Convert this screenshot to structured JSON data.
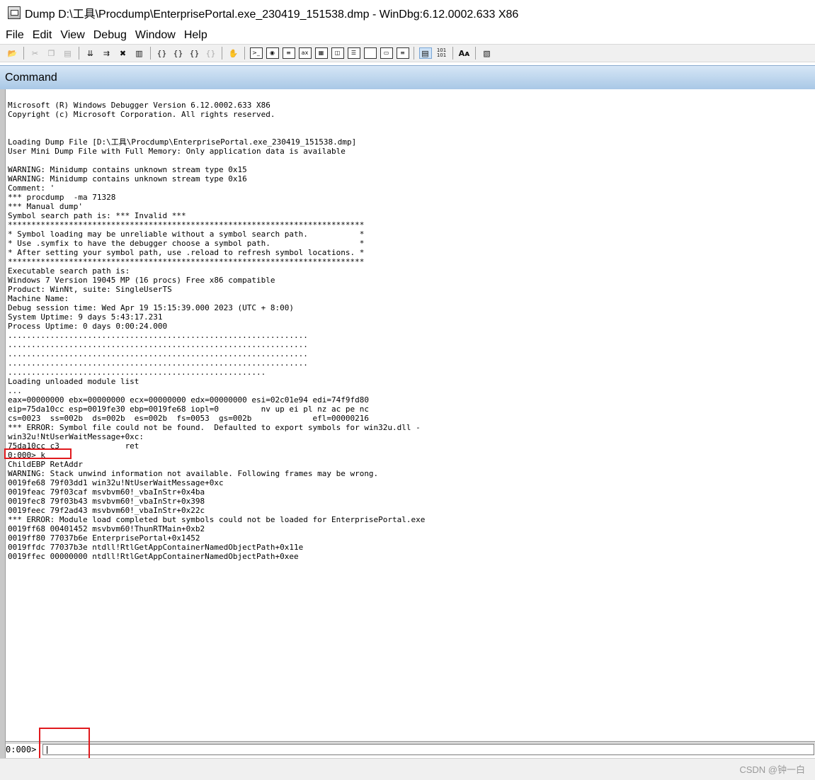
{
  "window": {
    "title": "Dump D:\\工具\\Procdump\\EnterprisePortal.exe_230419_151538.dmp - WinDbg:6.12.0002.633 X86"
  },
  "menu": [
    "File",
    "Edit",
    "View",
    "Debug",
    "Window",
    "Help"
  ],
  "toolbar": {
    "buttons": [
      "open-icon",
      "cut-icon",
      "copy-icon",
      "paste-icon",
      "step-into-icon",
      "step-over-icon",
      "break-icon",
      "restart-icon",
      "go-icon",
      "step-out-icon",
      "run-to-cursor-icon",
      "disabled-icon",
      "hand-icon",
      "command-window-icon",
      "watch-icon",
      "locals-icon",
      "registers-icon",
      "memory-icon",
      "call-stack-icon",
      "disassembly-icon",
      "scratch-pad-icon",
      "processes-icon",
      "source-mode-icon",
      "hex-icon",
      "font-icon",
      "options-icon"
    ]
  },
  "command_window": {
    "title": "Command",
    "output": "Microsoft (R) Windows Debugger Version 6.12.0002.633 X86\nCopyright (c) Microsoft Corporation. All rights reserved.\n\n\nLoading Dump File [D:\\工具\\Procdump\\EnterprisePortal.exe_230419_151538.dmp]\nUser Mini Dump File with Full Memory: Only application data is available\n\nWARNING: Minidump contains unknown stream type 0x15\nWARNING: Minidump contains unknown stream type 0x16\nComment: '\n*** procdump  -ma 71328\n*** Manual dump'\nSymbol search path is: *** Invalid ***\n****************************************************************************\n* Symbol loading may be unreliable without a symbol search path.           *\n* Use .symfix to have the debugger choose a symbol path.                   *\n* After setting your symbol path, use .reload to refresh symbol locations. *\n****************************************************************************\nExecutable search path is:\nWindows 7 Version 19045 MP (16 procs) Free x86 compatible\nProduct: WinNt, suite: SingleUserTS\nMachine Name:\nDebug session time: Wed Apr 19 15:15:39.000 2023 (UTC + 8:00)\nSystem Uptime: 9 days 5:43:17.231\nProcess Uptime: 0 days 0:00:24.000\n................................................................\n................................................................\n................................................................\n................................................................\n.......................................................\nLoading unloaded module list\n...\neax=00000000 ebx=00000000 ecx=00000000 edx=00000000 esi=02c01e94 edi=74f9fd80\neip=75da10cc esp=0019fe30 ebp=0019fe68 iopl=0         nv up ei pl nz ac pe nc\ncs=0023  ss=002b  ds=002b  es=002b  fs=0053  gs=002b             efl=00000216\n*** ERROR: Symbol file could not be found.  Defaulted to export symbols for win32u.dll -\nwin32u!NtUserWaitMessage+0xc:\n75da10cc c3              ret\n0:000> k\nChildEBP RetAddr\nWARNING: Stack unwind information not available. Following frames may be wrong.\n0019fe68 79f03dd1 win32u!NtUserWaitMessage+0xc\n0019feac 79f03caf msvbvm60!_vbaInStr+0x4ba\n0019fec8 79f03b43 msvbvm60!_vbaInStr+0x398\n0019feec 79f2ad43 msvbvm60!_vbaInStr+0x22c\n*** ERROR: Module load completed but symbols could not be loaded for EnterprisePortal.exe\n0019ff68 00401452 msvbvm60!ThunRTMain+0xb2\n0019ff80 77037b6e EnterprisePortal+0x1452\n0019ffdc 77037b3e ntdll!RtlGetAppContainerNamedObjectPath+0x11e\n0019ffec 00000000 ntdll!RtlGetAppContainerNamedObjectPath+0xee",
    "prompt": "0:000>",
    "input_value": ""
  },
  "watermark": "CSDN @钟一白"
}
